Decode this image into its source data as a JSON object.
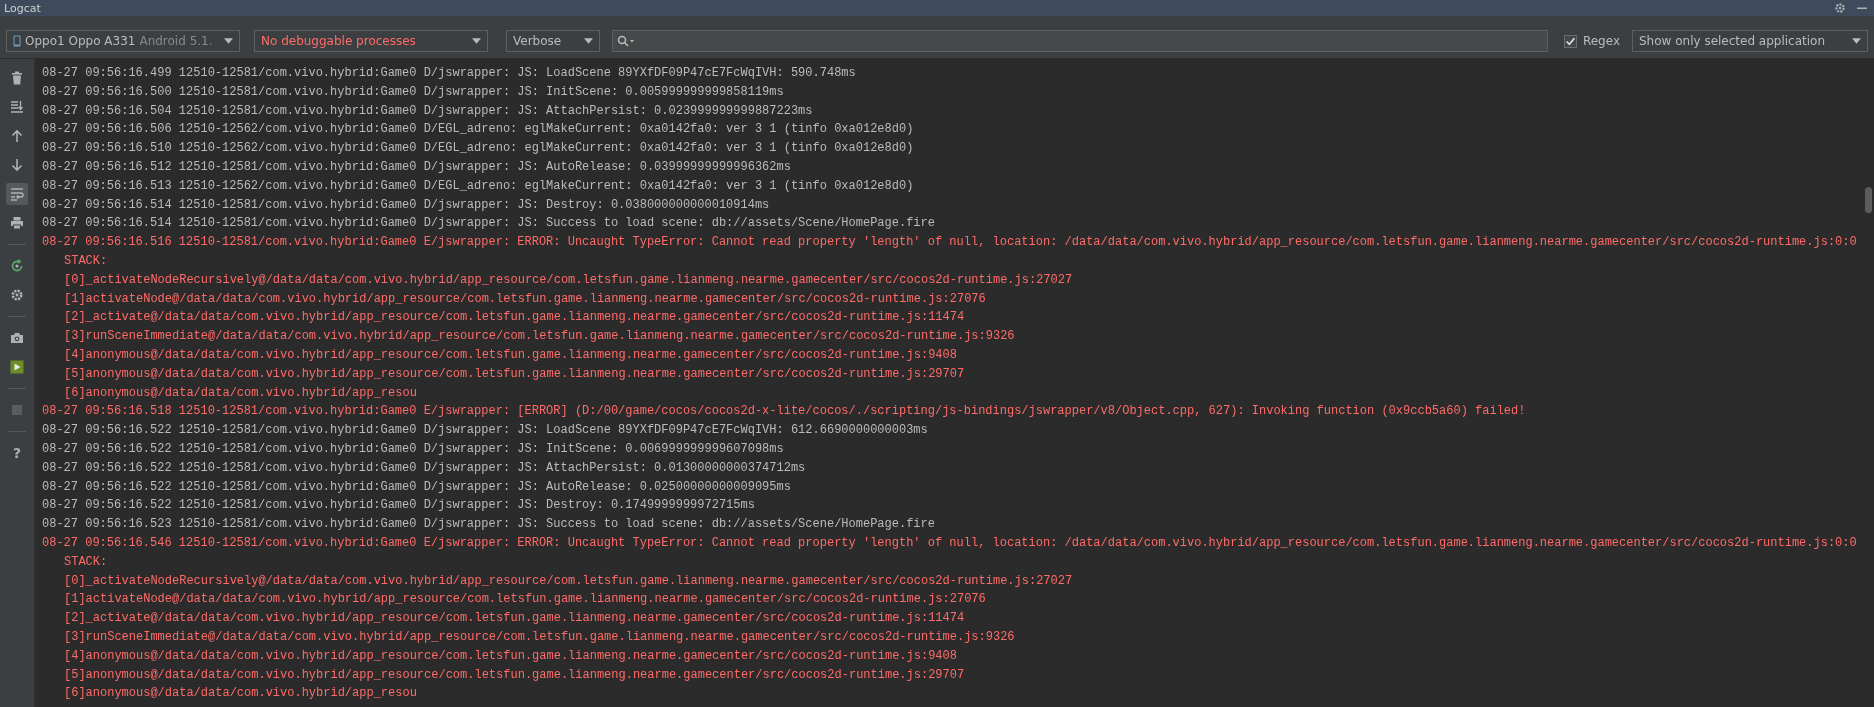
{
  "window": {
    "title": "Logcat"
  },
  "toolbar": {
    "device": {
      "name": "Oppo1 Oppo A331",
      "version": "Android 5.1."
    },
    "process": "No debuggable processes",
    "log_level": "Verbose",
    "regex": {
      "label": "Regex",
      "checked": true
    },
    "filter": "Show only selected application"
  },
  "tools": [
    {
      "kind": "trash",
      "selected": false
    },
    {
      "kind": "scroll-end",
      "selected": false
    },
    {
      "kind": "up",
      "selected": false
    },
    {
      "kind": "down",
      "selected": false
    },
    {
      "kind": "wrap",
      "selected": true
    },
    {
      "kind": "print",
      "selected": false
    },
    {
      "kind": "restart",
      "selected": false
    },
    {
      "kind": "settings",
      "selected": false
    },
    {
      "kind": "camera",
      "selected": false
    },
    {
      "kind": "record",
      "selected": false
    },
    {
      "kind": "stop",
      "selected": false
    },
    {
      "kind": "help",
      "selected": false,
      "label": "?"
    }
  ],
  "lines": [
    {
      "kind": "debug",
      "text": "08-27 09:56:16.499 12510-12581/com.vivo.hybrid:Game0 D/jswrapper: JS: LoadScene 89YXfDF09P47cE7FcWqIVH: 590.748ms"
    },
    {
      "kind": "debug",
      "text": "08-27 09:56:16.500 12510-12581/com.vivo.hybrid:Game0 D/jswrapper: JS: InitScene: 0.005999999999858119ms"
    },
    {
      "kind": "debug",
      "text": "08-27 09:56:16.504 12510-12581/com.vivo.hybrid:Game0 D/jswrapper: JS: AttachPersist: 0.023999999999887223ms"
    },
    {
      "kind": "debug",
      "text": "08-27 09:56:16.506 12510-12562/com.vivo.hybrid:Game0 D/EGL_adreno: eglMakeCurrent: 0xa0142fa0: ver 3 1 (tinfo 0xa012e8d0)"
    },
    {
      "kind": "debug",
      "text": "08-27 09:56:16.510 12510-12562/com.vivo.hybrid:Game0 D/EGL_adreno: eglMakeCurrent: 0xa0142fa0: ver 3 1 (tinfo 0xa012e8d0)"
    },
    {
      "kind": "debug",
      "text": "08-27 09:56:16.512 12510-12581/com.vivo.hybrid:Game0 D/jswrapper: JS: AutoRelease: 0.03999999999996362ms"
    },
    {
      "kind": "debug",
      "text": "08-27 09:56:16.513 12510-12562/com.vivo.hybrid:Game0 D/EGL_adreno: eglMakeCurrent: 0xa0142fa0: ver 3 1 (tinfo 0xa012e8d0)"
    },
    {
      "kind": "debug",
      "text": "08-27 09:56:16.514 12510-12581/com.vivo.hybrid:Game0 D/jswrapper: JS: Destroy: 0.038000000000010914ms"
    },
    {
      "kind": "debug",
      "text": "08-27 09:56:16.514 12510-12581/com.vivo.hybrid:Game0 D/jswrapper: JS: Success to load scene: db://assets/Scene/HomePage.fire"
    },
    {
      "kind": "error",
      "text": "08-27 09:56:16.516 12510-12581/com.vivo.hybrid:Game0 E/jswrapper: ERROR: Uncaught TypeError: Cannot read property 'length' of null, location: /data/data/com.vivo.hybrid/app_resource/com.letsfun.game.lianmeng.nearme.gamecenter/src/cocos2d-runtime.js:0:0"
    },
    {
      "kind": "stack",
      "text": "STACK:"
    },
    {
      "kind": "stack",
      "text": "[0]_activateNodeRecursively@/data/data/com.vivo.hybrid/app_resource/com.letsfun.game.lianmeng.nearme.gamecenter/src/cocos2d-runtime.js:27027"
    },
    {
      "kind": "stack",
      "text": "[1]activateNode@/data/data/com.vivo.hybrid/app_resource/com.letsfun.game.lianmeng.nearme.gamecenter/src/cocos2d-runtime.js:27076"
    },
    {
      "kind": "stack",
      "text": "[2]_activate@/data/data/com.vivo.hybrid/app_resource/com.letsfun.game.lianmeng.nearme.gamecenter/src/cocos2d-runtime.js:11474"
    },
    {
      "kind": "stack",
      "text": "[3]runSceneImmediate@/data/data/com.vivo.hybrid/app_resource/com.letsfun.game.lianmeng.nearme.gamecenter/src/cocos2d-runtime.js:9326"
    },
    {
      "kind": "stack",
      "text": "[4]anonymous@/data/data/com.vivo.hybrid/app_resource/com.letsfun.game.lianmeng.nearme.gamecenter/src/cocos2d-runtime.js:9408"
    },
    {
      "kind": "stack",
      "text": "[5]anonymous@/data/data/com.vivo.hybrid/app_resource/com.letsfun.game.lianmeng.nearme.gamecenter/src/cocos2d-runtime.js:29707"
    },
    {
      "kind": "stack",
      "text": "[6]anonymous@/data/data/com.vivo.hybrid/app_resou"
    },
    {
      "kind": "error",
      "text": "08-27 09:56:16.518 12510-12581/com.vivo.hybrid:Game0 E/jswrapper: [ERROR] (D:/00/game/cocos/cocos2d-x-lite/cocos/./scripting/js-bindings/jswrapper/v8/Object.cpp, 627): Invoking function (0x9ccb5a60) failed!"
    },
    {
      "kind": "debug",
      "text": "08-27 09:56:16.522 12510-12581/com.vivo.hybrid:Game0 D/jswrapper: JS: LoadScene 89YXfDF09P47cE7FcWqIVH: 612.6690000000003ms"
    },
    {
      "kind": "debug",
      "text": "08-27 09:56:16.522 12510-12581/com.vivo.hybrid:Game0 D/jswrapper: JS: InitScene: 0.006999999999607098ms"
    },
    {
      "kind": "debug",
      "text": "08-27 09:56:16.522 12510-12581/com.vivo.hybrid:Game0 D/jswrapper: JS: AttachPersist: 0.01300000000374712ms"
    },
    {
      "kind": "debug",
      "text": "08-27 09:56:16.522 12510-12581/com.vivo.hybrid:Game0 D/jswrapper: JS: AutoRelease: 0.02500000000009095ms"
    },
    {
      "kind": "debug",
      "text": "08-27 09:56:16.522 12510-12581/com.vivo.hybrid:Game0 D/jswrapper: JS: Destroy: 0.1749999999972715ms"
    },
    {
      "kind": "debug",
      "text": "08-27 09:56:16.523 12510-12581/com.vivo.hybrid:Game0 D/jswrapper: JS: Success to load scene: db://assets/Scene/HomePage.fire"
    },
    {
      "kind": "error",
      "text": "08-27 09:56:16.546 12510-12581/com.vivo.hybrid:Game0 E/jswrapper: ERROR: Uncaught TypeError: Cannot read property 'length' of null, location: /data/data/com.vivo.hybrid/app_resource/com.letsfun.game.lianmeng.nearme.gamecenter/src/cocos2d-runtime.js:0:0"
    },
    {
      "kind": "stack",
      "text": "STACK:"
    },
    {
      "kind": "stack",
      "text": "[0]_activateNodeRecursively@/data/data/com.vivo.hybrid/app_resource/com.letsfun.game.lianmeng.nearme.gamecenter/src/cocos2d-runtime.js:27027"
    },
    {
      "kind": "stack",
      "text": "[1]activateNode@/data/data/com.vivo.hybrid/app_resource/com.letsfun.game.lianmeng.nearme.gamecenter/src/cocos2d-runtime.js:27076"
    },
    {
      "kind": "stack",
      "text": "[2]_activate@/data/data/com.vivo.hybrid/app_resource/com.letsfun.game.lianmeng.nearme.gamecenter/src/cocos2d-runtime.js:11474"
    },
    {
      "kind": "stack",
      "text": "[3]runSceneImmediate@/data/data/com.vivo.hybrid/app_resource/com.letsfun.game.lianmeng.nearme.gamecenter/src/cocos2d-runtime.js:9326"
    },
    {
      "kind": "stack",
      "text": "[4]anonymous@/data/data/com.vivo.hybrid/app_resource/com.letsfun.game.lianmeng.nearme.gamecenter/src/cocos2d-runtime.js:9408"
    },
    {
      "kind": "stack",
      "text": "[5]anonymous@/data/data/com.vivo.hybrid/app_resource/com.letsfun.game.lianmeng.nearme.gamecenter/src/cocos2d-runtime.js:29707"
    },
    {
      "kind": "stack",
      "text": "[6]anonymous@/data/data/com.vivo.hybrid/app_resou"
    }
  ]
}
